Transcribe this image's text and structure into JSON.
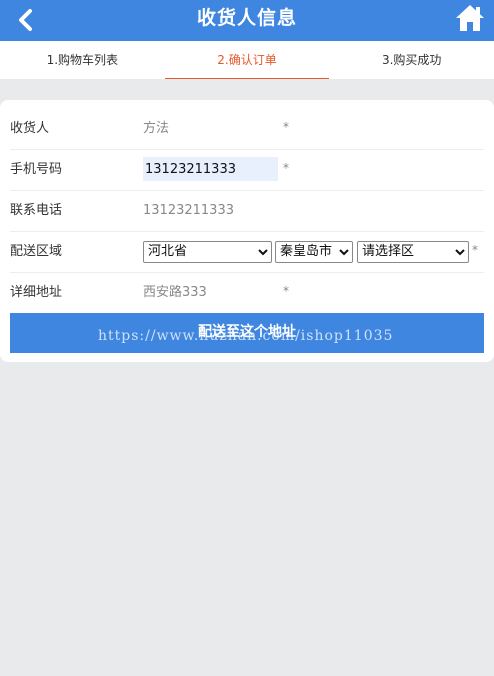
{
  "header": {
    "title": "收货人信息",
    "back_icon": "chevron-left-icon",
    "home_icon": "home-icon"
  },
  "steps": [
    {
      "label": "1.购物车列表",
      "active": false
    },
    {
      "label": "2.确认订单",
      "active": true
    },
    {
      "label": "3.购买成功",
      "active": false
    }
  ],
  "form": {
    "consignee": {
      "label": "收货人",
      "value": "方法",
      "required": "*"
    },
    "mobile": {
      "label": "手机号码",
      "value": "13123211333",
      "required": "*"
    },
    "phone": {
      "label": "联系电话",
      "value": "13123211333"
    },
    "region": {
      "label": "配送区域",
      "province": "河北省",
      "city": "秦皇岛市",
      "district": "请选择区",
      "required": "*"
    },
    "address": {
      "label": "详细地址",
      "value": "西安路333",
      "required": "*"
    },
    "submit_label": "配送至这个地址"
  },
  "watermark": "https://www.huzhan.com/ishop11035",
  "colors": {
    "primary": "#3f86e0",
    "active_step": "#e8572a",
    "background": "#e9eaec"
  }
}
